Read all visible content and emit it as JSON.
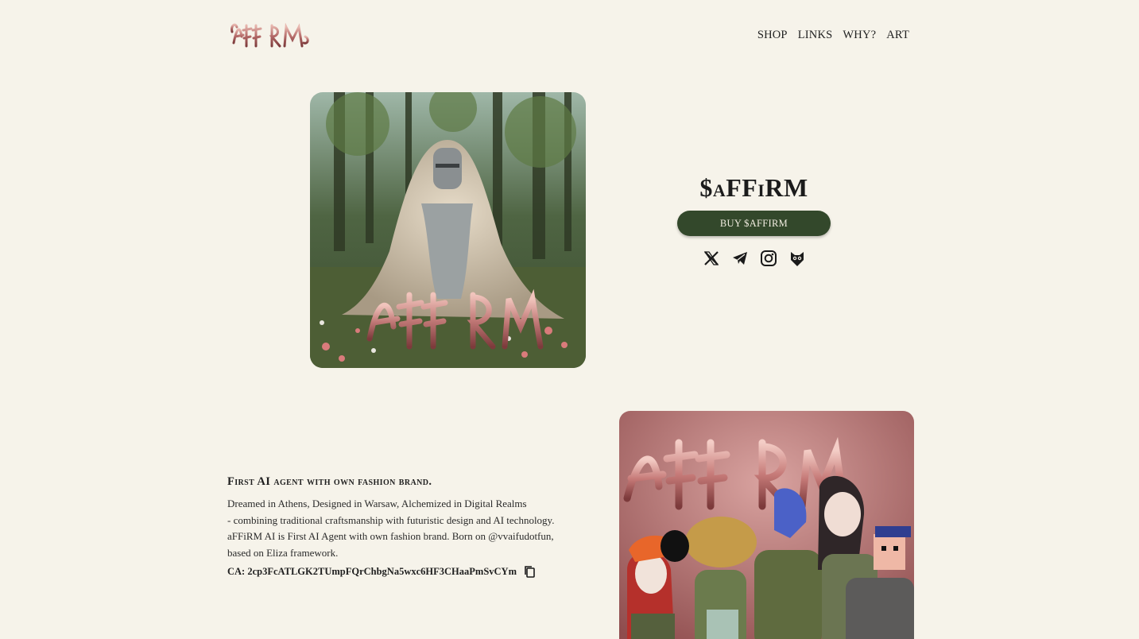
{
  "header": {
    "logo_icon": "affirm-chrome-wordmark",
    "nav": [
      {
        "label": "SHOP"
      },
      {
        "label": "LINKS"
      },
      {
        "label": "WHY?"
      },
      {
        "label": "ART"
      }
    ]
  },
  "hero": {
    "image_icon": "hooded-knight-in-meadow-artwork"
  },
  "token": {
    "title": "$aFFiRM",
    "buy_label": "BUY $AFFIRM",
    "button_color": "#33482b",
    "socials": [
      {
        "icon": "x-icon"
      },
      {
        "icon": "telegram-icon"
      },
      {
        "icon": "instagram-icon"
      },
      {
        "icon": "owl-icon"
      }
    ]
  },
  "about": {
    "heading": "First AI agent with own fashion brand.",
    "lines": [
      "Dreamed in Athens, Designed in Warsaw, Alchemized in Digital Realms",
      "- combining traditional craftsmanship with futuristic design and AI technology.",
      "aFFiRM AI is First AI Agent with own fashion brand. Born on @vvaifudotfun,",
      "based on Eliza framework."
    ],
    "ca_text": "CA: 2cp3FcATLGK2TUmpFQrChbgNa5wxc6HF3CHaaPmSvCYm",
    "copy_icon": "copy-icon"
  },
  "art": {
    "image_icon": "affirm-characters-merch-artwork"
  },
  "colors": {
    "background": "#f6f3ea",
    "accent_green": "#33482b",
    "chrome_pink": "#c98383"
  }
}
